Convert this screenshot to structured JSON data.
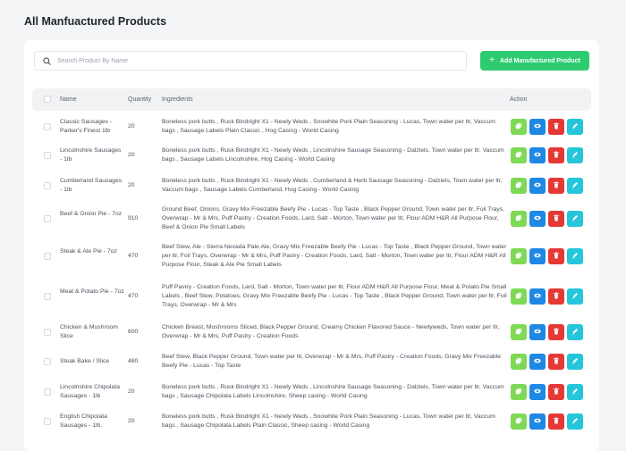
{
  "page": {
    "title": "All Manfuactured Products"
  },
  "search": {
    "placeholder": "Search Product By Name"
  },
  "add_button": {
    "label": "Add Manufactured Product"
  },
  "table": {
    "headers": {
      "name": "Name",
      "quantity": "Quantity",
      "ingredients": "Ingredients",
      "action": "Action"
    },
    "rows": [
      {
        "name": "Classic Sausages - Parker's Finest 1lb",
        "quantity": "20",
        "ingredients": "Boneless pork butts , Rusk Bindright X1 - Newly Weds , Snowhite Pork Plain Seasoning - Lucas, Town water per ltr, Vaccum bags , Sausage Labels Plain Classic , Hog Casing - World Casing"
      },
      {
        "name": "Lincolnshire Sausages - 1lb",
        "quantity": "20",
        "ingredients": "Boneless pork butts , Rusk Bindright X1 - Newly Weds , Lincolnshire Sausage Seasoning - Dalziels, Town water per ltr, Vaccum bags , Sausage Labels Lincolnshire, Hog Casing - World Casing"
      },
      {
        "name": "Cumberland Sausages - 1lb",
        "quantity": "20",
        "ingredients": "Boneless pork butts , Rusk Bindright X1 - Newly Weds , Cumberland & Herb Sausage Seasoning - Dalziels, Town water per ltr, Vaccum bags , Sausage Labels Cumberland, Hog Casing - World Casing"
      },
      {
        "name": "Beef & Onion Pie - 7oz",
        "quantity": "910",
        "ingredients": "Ground Beef, Onions, Gravy Mix Freezable Beefy Pie - Lucas - Top Taste , Black Pepper Ground, Town water per ltr, Foil Trays, Overwrap - Mr & Mrs, Puff Pastry - Creation Foods, Lard, Salt - Morton, Town water per ltr, Flour ADM H&R All Purpose Flour, Beef & Onion Pie Small Labels"
      },
      {
        "name": "Steak & Ale Pie - 7oz",
        "quantity": "470",
        "ingredients": "Beef Stew, Ale - Sierra Nevada Pale Ale, Gravy Mix Freezable Beefy Pie - Lucas - Top Taste , Black Pepper Ground, Town water per ltr, Foil Trays, Overwrap - Mr & Mrs, Puff Pastry - Creation Foods, Lard, Salt - Morton, Town water per ltr, Flour ADM H&R All Purpose Flour, Steak & Ale Pie Small Labels"
      },
      {
        "name": "Meat & Potato Pie - 7oz",
        "quantity": "470",
        "ingredients": "Puff Pastry - Creation Foods, Lard, Salt - Morton, Town water per ltr, Flour ADM H&R All Purpose Flour, Meat & Potato Pie Small Labels , Beef Stew, Potatoes, Gravy Mix Freezable Beefy Pie - Lucas - Top Taste , Black Pepper Ground, Town water per ltr, Foil Trays, Overwrap - Mr & Mrs"
      },
      {
        "name": "Chicken & Mushroom Slice",
        "quantity": "600",
        "ingredients": "Chicken Breast, Mushrooms Sliced, Black Pepper Ground, Creamy Chicken Flavored Sauce - Newlyweds, Town water per ltr, Overwrap - Mr & Mrs, Puff Pastry - Creation Foods"
      },
      {
        "name": "Steak Bake / Slice",
        "quantity": "480",
        "ingredients": "Beef Stew, Black Pepper Ground, Town water per ltr, Overwrap - Mr & Mrs, Puff Pastry - Creation Foods, Gravy Mix Freezable Beefy Pie - Lucas - Top Taste"
      },
      {
        "name": "Lincolnshire Chipolata Sausages - 1lb",
        "quantity": "20",
        "ingredients": "Boneless pork butts , Rusk Bindright X1 - Newly Weds , Lincolnshire Sausage Seasoning - Dalziels, Town water per ltr, Vaccum bags , Sausage Chipolata Labels Lincolnshire, Sheep casing - World Casing"
      },
      {
        "name": "English Chipolata Sausages - 1lb.",
        "quantity": "20",
        "ingredients": "Boneless pork butts , Rusk Bindright X1 - Newly Weds , Snowhite Pork Plain Seasoning - Lucas, Town water per ltr, Vaccum bags , Sausage Chipolata Labels Plain Classic, Sheep casing - World Casing"
      }
    ]
  },
  "icons": {
    "copy": "copy-icon",
    "view": "eye-icon",
    "delete": "trash-icon",
    "edit": "pencil-icon"
  },
  "colors": {
    "add": "#2ecc71",
    "copy": "#7ed957",
    "view": "#1e88e5",
    "delete": "#e53935",
    "edit": "#26c6da"
  }
}
